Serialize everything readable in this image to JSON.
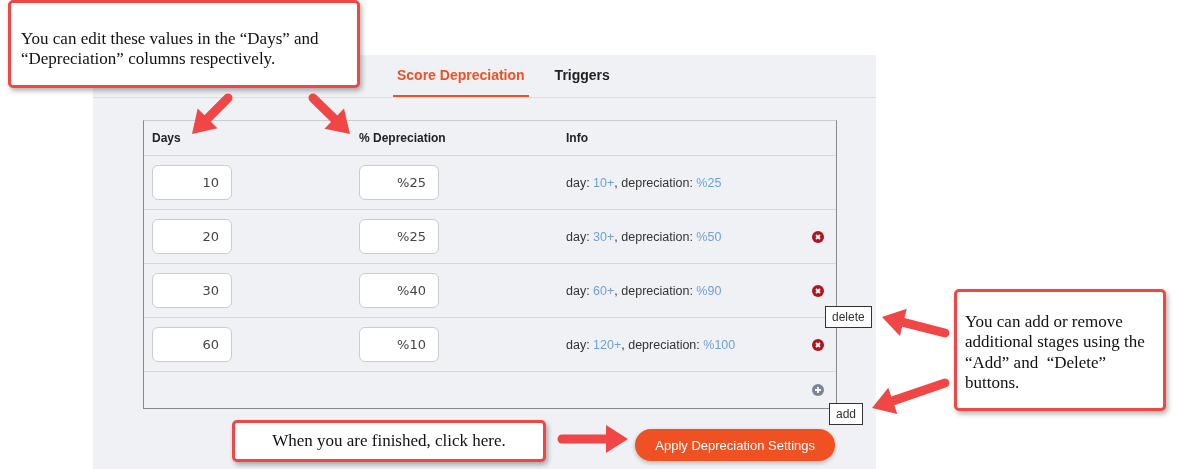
{
  "tabs": [
    {
      "label": "Score Depreciation",
      "selected": true
    },
    {
      "label": "Triggers",
      "selected": false
    }
  ],
  "table": {
    "columns": [
      "Days",
      "% Depreciation",
      "Info"
    ],
    "rows": [
      {
        "days": "10",
        "depreciation": "%25",
        "info": {
          "label_1": "day:",
          "day": "10+",
          "label_2": ", depreciation:",
          "depreciation": "%25"
        },
        "deletable": false
      },
      {
        "days": "20",
        "depreciation": "%25",
        "info": {
          "label_1": "day:",
          "day": "30+",
          "label_2": ", depreciation:",
          "depreciation": "%50"
        },
        "deletable": true
      },
      {
        "days": "30",
        "depreciation": "%40",
        "info": {
          "label_1": "day:",
          "day": "60+",
          "label_2": ", depreciation:",
          "depreciation": "%90"
        },
        "deletable": true
      },
      {
        "days": "60",
        "depreciation": "%10",
        "info": {
          "label_1": "day:",
          "day": "120+",
          "label_2": ", depreciation:",
          "depreciation": "%100"
        },
        "deletable": true
      }
    ]
  },
  "tooltips": {
    "delete": "delete",
    "add": "add"
  },
  "apply_button": "Apply Depreciation Settings",
  "callouts": [
    {
      "text": "You can edit these values in the “Days” and “Depreciation” columns respectively."
    },
    {
      "text": "You can add or remove additional stages using the “Add” and  “Delete” buttons."
    },
    {
      "text": "When you are finished, click here."
    }
  ]
}
